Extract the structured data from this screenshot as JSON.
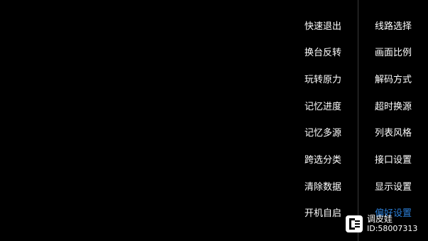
{
  "menu": {
    "left": [
      {
        "label": "快速退出"
      },
      {
        "label": "换台反转"
      },
      {
        "label": "玩转原力"
      },
      {
        "label": "记忆进度"
      },
      {
        "label": "记忆多源"
      },
      {
        "label": "跨选分类"
      },
      {
        "label": "清除数据"
      },
      {
        "label": "开机自启"
      }
    ],
    "right": [
      {
        "label": "线路选择"
      },
      {
        "label": "画面比例"
      },
      {
        "label": "解码方式"
      },
      {
        "label": "超时换源"
      },
      {
        "label": "列表风格"
      },
      {
        "label": "接口设置"
      },
      {
        "label": "显示设置"
      },
      {
        "label": "偏好设置"
      }
    ],
    "active_color": "#2b7fd8"
  },
  "watermark": {
    "name": "调皮娃",
    "id": "ID:58007313",
    "icon": "app-logo-icon"
  }
}
